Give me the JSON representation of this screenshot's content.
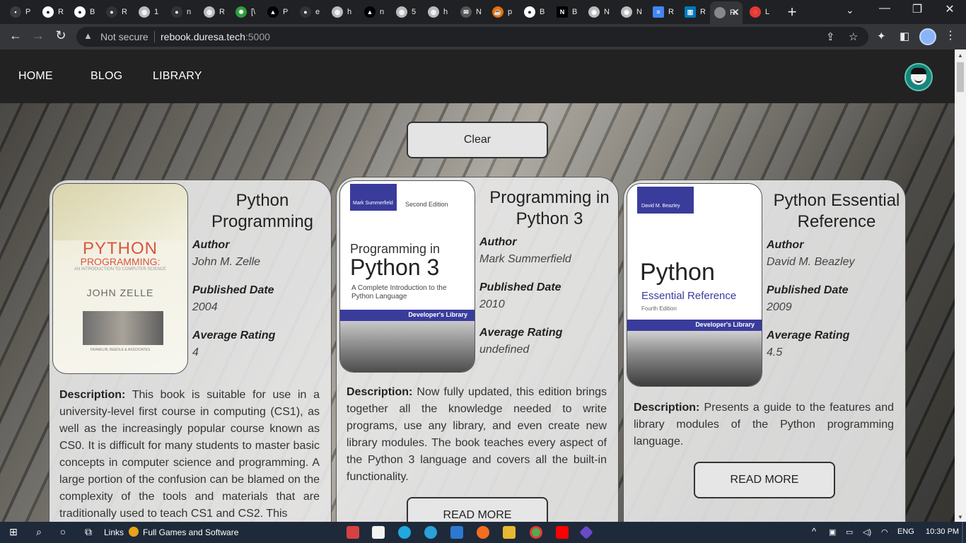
{
  "browser": {
    "tabs": [
      {
        "label": "P",
        "icon": "app-icon",
        "color": "#3c3c3c"
      },
      {
        "label": "R",
        "icon": "github-icon",
        "color": "#ffffff"
      },
      {
        "label": "B",
        "icon": "github-icon",
        "color": "#ffffff"
      },
      {
        "label": "R",
        "icon": "github-icon",
        "color": "#333333"
      },
      {
        "label": "1",
        "icon": "globe-icon",
        "color": "#bbbbbb"
      },
      {
        "label": "n",
        "icon": "github-icon",
        "color": "#333333"
      },
      {
        "label": "R",
        "icon": "globe-icon",
        "color": "#bbbbbb"
      },
      {
        "label": "[\\",
        "icon": "gear-icon",
        "color": "#2e9e3e"
      },
      {
        "label": "P",
        "icon": "triangle-icon",
        "color": "#000000"
      },
      {
        "label": "e",
        "icon": "github-icon",
        "color": "#333333"
      },
      {
        "label": "h",
        "icon": "globe-icon",
        "color": "#bbbbbb"
      },
      {
        "label": "n",
        "icon": "triangle-icon",
        "color": "#000000"
      },
      {
        "label": "5",
        "icon": "globe-icon",
        "color": "#bbbbbb"
      },
      {
        "label": "h",
        "icon": "globe-icon",
        "color": "#bbbbbb"
      },
      {
        "label": "N",
        "icon": "mail-icon",
        "color": "#555555"
      },
      {
        "label": "p",
        "icon": "java-icon",
        "color": "#e76f00"
      },
      {
        "label": "B",
        "icon": "github-icon",
        "color": "#ffffff"
      },
      {
        "label": "B",
        "icon": "notion-icon",
        "color": "#000000"
      },
      {
        "label": "N",
        "icon": "chrome-icon",
        "color": "#bbbbbb"
      },
      {
        "label": "N",
        "icon": "chrome-icon",
        "color": "#bbbbbb"
      },
      {
        "label": "R",
        "icon": "docs-icon",
        "color": "#4285f4"
      },
      {
        "label": "R",
        "icon": "trello-icon",
        "color": "#0079bf"
      },
      {
        "label": "Re",
        "icon": "page-icon",
        "color": "#888888",
        "active": true
      },
      {
        "label": "L",
        "icon": "loading-icon",
        "color": "#e53935"
      }
    ],
    "new_tab": "+",
    "address": {
      "security_label": "Not secure",
      "host": "rebook.duresa.tech",
      "port": ":5000"
    }
  },
  "site": {
    "nav": {
      "home": "HOME",
      "blog": "BLOG",
      "library": "LIBRARY"
    },
    "clear_label": "Clear",
    "labels": {
      "author": "Author",
      "published": "Published Date",
      "rating": "Average Rating",
      "description": "Description:",
      "read_more": "READ MORE"
    },
    "books": [
      {
        "title": "Python Programming",
        "author": "John M. Zelle",
        "published": "2004",
        "rating": "4",
        "description": "This book is suitable for use in a university-level first course in computing (CS1), as well as the increasingly popular course known as CS0. It is difficult for many students to master basic concepts in computer science and programming. A large portion of the confusion can be blamed on the complexity of the tools and materials that are traditionally used to teach CS1 and CS2. This",
        "cover": {
          "title_line1": "PYTHON",
          "title_line2": "PROGRAMMING:",
          "subtitle": "AN INTRODUCTION TO COMPUTER SCIENCE",
          "author": "JOHN ZELLE",
          "footer": "FRANKLIN, BEEDLE & ASSOCIATES"
        }
      },
      {
        "title": "Programming in Python 3",
        "author": "Mark Summerfield",
        "published": "2010",
        "rating": "undefined",
        "description": "Now fully updated, this edition brings together all the knowledge needed to write programs, use any library, and even create new library modules. The book teaches every aspect of the Python 3 language and covers all the built-in functionality.",
        "cover": {
          "author": "Mark Summerfield",
          "edition": "Second Edition",
          "title_line1": "Programming in",
          "title_line2": "Python 3",
          "subtitle": "A Complete Introduction to the Python Language",
          "series": "Developer's Library"
        }
      },
      {
        "title": "Python Essential Reference",
        "author": "David M. Beazley",
        "published": "2009",
        "rating": "4.5",
        "description": "Presents a guide to the features and library modules of the Python programming language.",
        "cover": {
          "author": "David M. Beazley",
          "title_line1": "Python",
          "title_line2": "Essential Reference",
          "edition": "Fourth Edition",
          "series": "Developer's Library"
        }
      }
    ]
  },
  "taskbar": {
    "links_label": "Links",
    "fgs_label": "Full Games and Software",
    "lang": "ENG",
    "time": "10:30 PM"
  }
}
